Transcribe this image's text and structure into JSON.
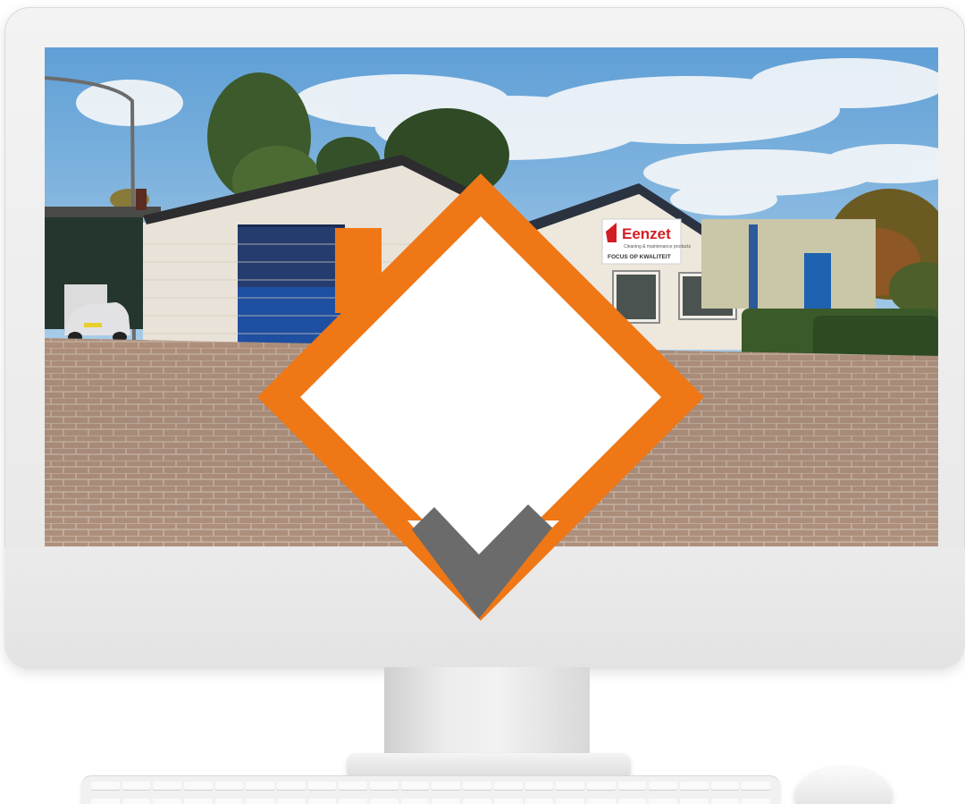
{
  "scene": {
    "signage": {
      "brand_name": "Eenzet",
      "brand_tagline": "Cleaning & maintenance products",
      "slogan": "FOCUS OP KWALITEIT"
    },
    "colors": {
      "logo_orange": "#ef7716",
      "logo_gray": "#6b6b6b",
      "brand_red": "#d21f26"
    },
    "objects": {
      "monitor": "desktop-monitor",
      "keyboard": "keyboard",
      "mouse": "mouse"
    }
  }
}
